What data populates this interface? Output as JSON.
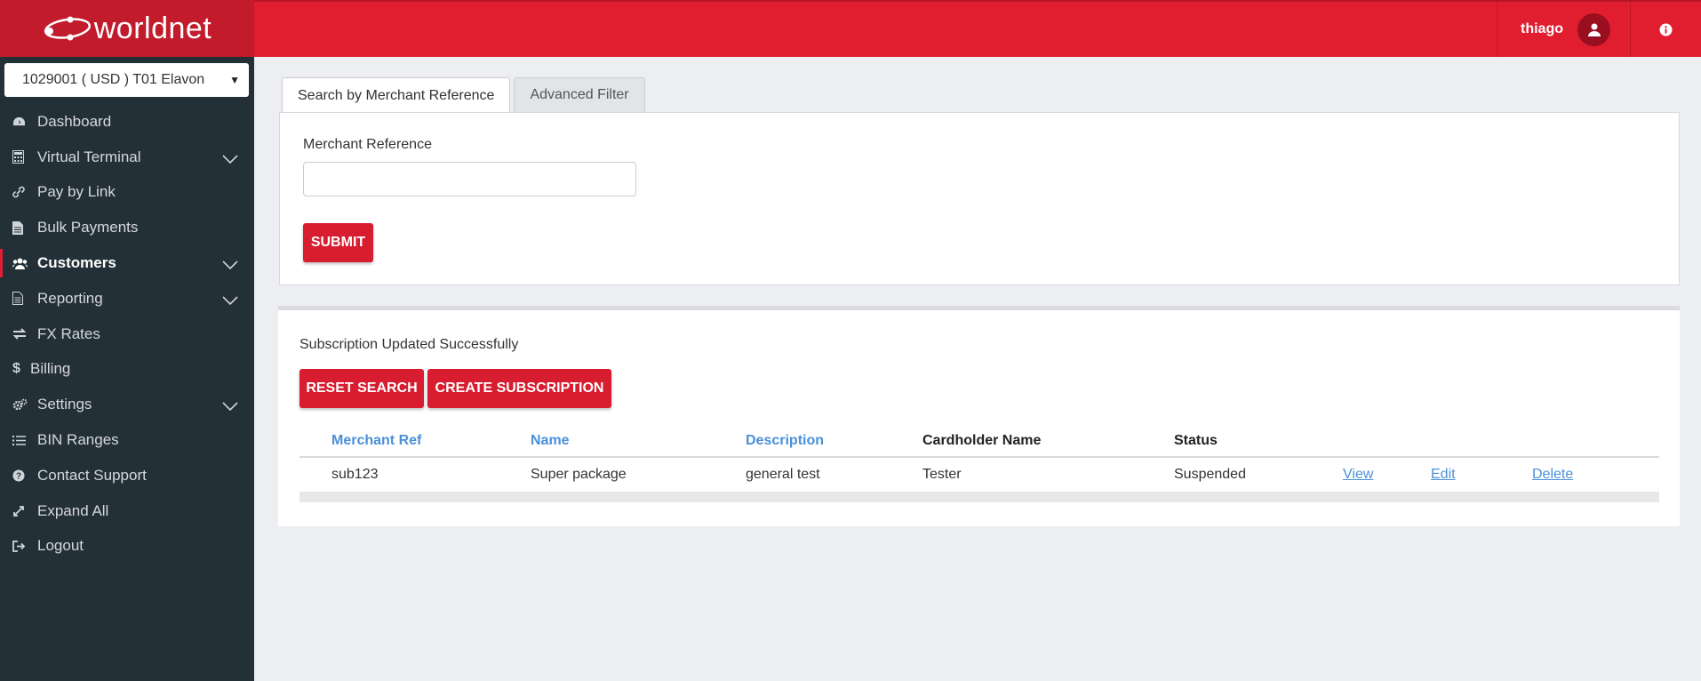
{
  "brand": {
    "logo_text": "worldnet",
    "accent": "#e11d30",
    "sidebar_bg": "#243038"
  },
  "merchant": {
    "selected": "1029001 ( USD ) T01 Elavon"
  },
  "nav": [
    {
      "label": "Dashboard",
      "icon": "dashboard-icon"
    },
    {
      "label": "Virtual Terminal",
      "icon": "calculator-icon",
      "expandable": true
    },
    {
      "label": "Pay by Link",
      "icon": "link-icon"
    },
    {
      "label": "Bulk Payments",
      "icon": "file-icon"
    },
    {
      "label": "Customers",
      "icon": "users-icon",
      "expandable": true,
      "active": true
    },
    {
      "label": "Reporting",
      "icon": "report-icon",
      "expandable": true
    },
    {
      "label": "FX Rates",
      "icon": "exchange-icon"
    },
    {
      "label": "Billing",
      "icon": "dollar-icon"
    },
    {
      "label": "Settings",
      "icon": "gears-icon",
      "expandable": true
    },
    {
      "label": "BIN Ranges",
      "icon": "list-icon"
    },
    {
      "label": "Contact Support",
      "icon": "question-icon"
    },
    {
      "label": "Expand All",
      "icon": "expand-icon"
    },
    {
      "label": "Logout",
      "icon": "logout-icon"
    }
  ],
  "header": {
    "username": "thiago"
  },
  "search": {
    "tabs": [
      "Search by Merchant Reference",
      "Advanced Filter"
    ],
    "field_label": "Merchant Reference",
    "field_value": "",
    "submit_label": "SUBMIT"
  },
  "results": {
    "message": "Subscription Updated Successfully",
    "reset_label": "RESET SEARCH",
    "create_label": "CREATE SUBSCRIPTION",
    "columns": [
      "Merchant Ref",
      "Name",
      "Description",
      "Cardholder Name",
      "Status"
    ],
    "rows": [
      {
        "merchant_ref": "sub123",
        "name": "Super package",
        "description": "general test",
        "cardholder": "Tester",
        "status": "Suspended",
        "actions": [
          "View",
          "Edit",
          "Delete"
        ]
      }
    ]
  }
}
